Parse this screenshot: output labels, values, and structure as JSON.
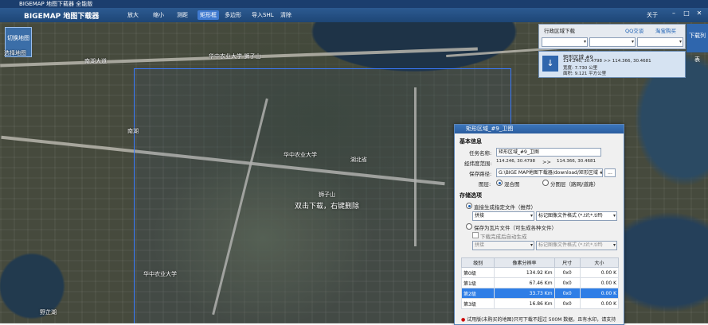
{
  "app": {
    "title": "BIGEMAP 地图下载器 全能版",
    "logo": "BIGEMAP 地图下载器"
  },
  "toolbar": {
    "items": [
      {
        "label": "放大"
      },
      {
        "label": "缩小"
      },
      {
        "label": "测距"
      },
      {
        "label": "矩形框"
      },
      {
        "label": "多边形"
      },
      {
        "label": "导入SHL"
      },
      {
        "label": "清除"
      }
    ],
    "about": "关于"
  },
  "map_type_button": {
    "label": "切换地图",
    "sub": "选择地图"
  },
  "map": {
    "hint": "双击下载，右键删除",
    "labels": [
      "南湖大道",
      "华中农业大学-狮子山",
      "华中农业大学",
      "南湖",
      "湖北省",
      "野芷湖",
      "华中农业大学",
      "狮子山"
    ]
  },
  "search_panel": {
    "title": "行政区域下载",
    "qq": "QQ交谈",
    "hotline": "淘宝购买"
  },
  "download_card": {
    "name": "矩形区域 #9",
    "line1": "114.246, 30.4798 >> 114.366, 30.4681",
    "line2": "宽度: 7.730 公里",
    "line3": "面积: 9.121 平方公里"
  },
  "right_button": {
    "label": "下载列表"
  },
  "dialog": {
    "title": "矩形区域_#9_卫图",
    "basic_section": "基本信息",
    "task_label": "任务名称:",
    "task_value": "矩形区域_#9_卫图",
    "range_label": "经纬度范围:",
    "range_from": "114.246, 30.4798",
    "range_arrow": ">>",
    "range_to": "114.366, 30.4681",
    "path_label": "保存路径:",
    "path_value": "G:\\BIGE MAP地图下载器/download/矩形区域 #9",
    "browse": "...",
    "layer_label": "图层:",
    "layer_opt1": "混合图",
    "layer_opt2": "分图层（路网/道路）",
    "storage_section": "存储选项",
    "opt_direct": "直接生成指定文件（推荐）",
    "direct_select": "拼接",
    "direct_format": "标记图像文件格式 (*.tif;*.tiff)",
    "opt_tiles": "保存为瓦片文件（可生成各种文件）",
    "chk_auto": "下载完成后自动生成",
    "tiles_select": "拼接",
    "tiles_format": "标记图像文件格式 (*.tif;*.tiff)",
    "table": {
      "headers": [
        "级别",
        "像素分辨率",
        "尺寸",
        "大小"
      ],
      "rows": [
        [
          "第0级",
          "134.92 Km",
          "0x0",
          "0.00 K"
        ],
        [
          "第1级",
          "67.46 Km",
          "0x0",
          "0.00 K"
        ],
        [
          "第2级",
          "33.73 Km",
          "0x0",
          "0.00 K"
        ],
        [
          "第3级",
          "16.86 Km",
          "0x0",
          "0.00 K"
        ]
      ],
      "highlight_row": 2
    },
    "footnote": "试用版(未购买的地图)只可下载不超过 500M 数据，且有水印，请支持"
  },
  "colors": {
    "toolbar": "#2c5a91",
    "selection": "#3a7bff",
    "highlight": "#2f7ee6"
  }
}
